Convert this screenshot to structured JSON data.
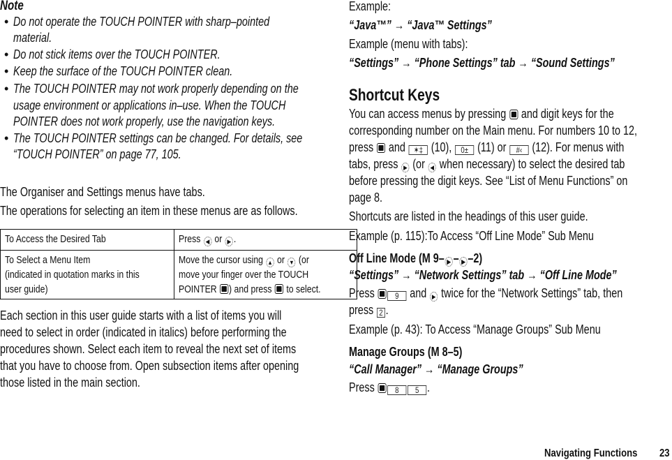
{
  "note": {
    "heading": "Note",
    "bullets": [
      [
        "Do not operate the TOUCH POINTER with sharp–pointed",
        "material."
      ],
      [
        "Do not stick items over the TOUCH POINTER."
      ],
      [
        "Keep the surface of the TOUCH POINTER clean."
      ],
      [
        "The TOUCH POINTER may not work properly depending on the",
        "usage environment or applications in–use. When the TOUCH",
        "POINTER does not work properly, use the navigation keys."
      ],
      [
        "The TOUCH POINTER settings can be changed. For details, see",
        "“TOUCH POINTER” on page 77, 105."
      ]
    ]
  },
  "intro": {
    "p1": "The Organiser and Settings menus have tabs.",
    "p2": "The operations for selecting an item in these menus are as follows."
  },
  "ops_table": {
    "rows": [
      {
        "left": [
          "To Access the Desired Tab"
        ],
        "right_a": "Press",
        "right_b": "or",
        "right_c": "."
      },
      {
        "left": [
          "To Select a Menu Item",
          "(indicated in quotation marks in this",
          "user guide)"
        ],
        "right_l1a": "Move the cursor using",
        "right_l1b": "or",
        "right_l1c": "(or",
        "right_l2": "move your finger over the TOUCH",
        "right_l3a": "POINTER",
        "right_l3b": ") and press",
        "right_l3c": "to select."
      }
    ]
  },
  "section_para": [
    "Each section in this user guide starts with a list of items you will",
    "need to select in order (indicated in italics) before performing the",
    "procedures shown. Select each item to reveal the next set of items",
    "that you have to choose from. Open subsection items after opening",
    "those listed in the main section."
  ],
  "examples": {
    "label1": "Example:",
    "path1": "“Java™” → “Java™ Settings”",
    "label2": "Example (menu with tabs):",
    "path2": "“Settings” → “Phone Settings” tab → “Sound Settings”"
  },
  "shortcut": {
    "heading": "Shortcut Keys",
    "l1a": "You can access menus by pressing",
    "l1b": "and digit keys for the",
    "l2": "corresponding number on the Main menu. For numbers 10 to 12,",
    "l3a": "press",
    "l3b": "and",
    "l3c": "(10),",
    "l3d": "(11) or",
    "l3e": "(12). For menus with",
    "key_star": "✶‡",
    "key_zero": "0±",
    "key_hash": "#‹",
    "l4a": "tabs, press",
    "l4b": "(or",
    "l4c": "when necessary) to select the desired tab",
    "l5": "before pressing the digit keys. See “List of Menu Functions” on",
    "l6": "page 8.",
    "p2": "Shortcuts are listed in the headings of this user guide.",
    "ex1": "Example (p. 115):To Access “Off Line Mode” Sub Menu"
  },
  "offline": {
    "heading_a": "Off Line Mode (M 9–",
    "heading_b": "–",
    "heading_c": "–2)",
    "path": "“Settings” → “Network Settings” tab → “Off Line Mode”",
    "l1a": "Press",
    "key9": "9",
    "l1b": "and",
    "l1c": "twice for the “Network Settings” tab, then",
    "l2a": "press",
    "key2": "2",
    "l2b": "."
  },
  "ex2": "Example (p. 43):  To Access “Manage Groups” Sub Menu",
  "groups": {
    "heading": "Manage Groups (M 8–5)",
    "path": "“Call Manager” → “Manage Groups”",
    "l1a": "Press",
    "key8": "8",
    "key5": "5",
    "l1b": "."
  },
  "footer": {
    "section": "Navigating Functions",
    "page": "23"
  }
}
